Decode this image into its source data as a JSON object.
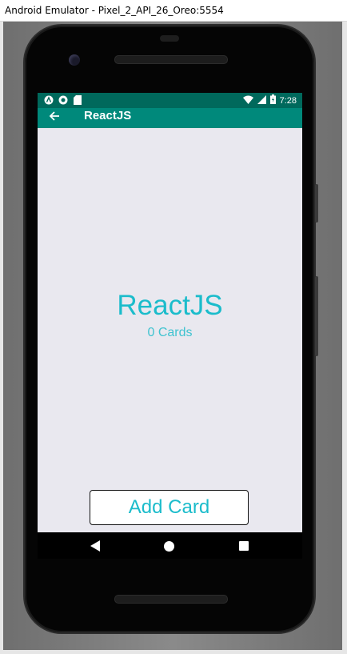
{
  "window": {
    "title": "Android Emulator - Pixel_2_API_26_Oreo:5554"
  },
  "status_bar": {
    "time": "7:28",
    "left_icons": [
      "notification-a-icon",
      "sync-circle-icon",
      "sd-card-icon"
    ],
    "right_icons": [
      "wifi-icon",
      "cell-signal-icon",
      "battery-icon"
    ]
  },
  "app_bar": {
    "title": "ReactJS",
    "back_icon": "arrow-back-icon"
  },
  "deck": {
    "title": "ReactJS",
    "card_count": "0 Cards"
  },
  "actions": {
    "add_card_label": "Add Card"
  },
  "nav_bar": {
    "icons": [
      "nav-back-icon",
      "nav-home-icon",
      "nav-recents-icon"
    ]
  },
  "colors": {
    "status_bar": "#00695c",
    "app_bar": "#00897b",
    "accent_text": "#1bbccb",
    "content_bg": "#e9e8ef"
  }
}
